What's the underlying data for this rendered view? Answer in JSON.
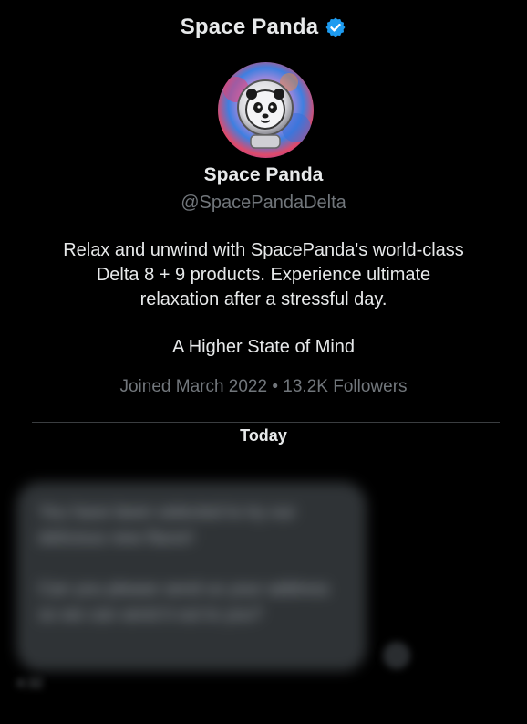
{
  "header": {
    "title": "Space Panda",
    "verified_icon": "verified-badge-icon",
    "verified_color": "#1d9bf0"
  },
  "profile": {
    "avatar_icon": "space-panda-avatar",
    "name": "Space Panda",
    "handle": "@SpacePandaDelta",
    "bio_lines": [
      "Relax and unwind with SpacePanda's world-class",
      "Delta 8 + 9 products. Experience ultimate",
      "relaxation after a stressful day."
    ],
    "tagline": "A Higher State of Mind",
    "joined": "Joined March 2022",
    "separator": "•",
    "followers": "13.2K Followers"
  },
  "conversation": {
    "date_label": "Today",
    "message": {
      "paragraphs": [
        "You have been selected to try our delicious new flavor!",
        "Can you please send us your address so we can send it out to you?"
      ],
      "timestamp": "4:32"
    }
  },
  "colors": {
    "background": "#000000",
    "primary_text": "#e7e9ea",
    "secondary_text": "#71767b",
    "bubble": "#2f3336",
    "divider": "#3a3d40"
  }
}
